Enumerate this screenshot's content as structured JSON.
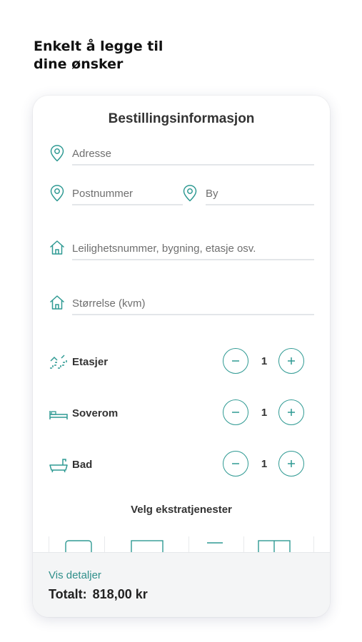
{
  "headline": {
    "line1": "Enkelt å legge til",
    "line2": "dine ønsker"
  },
  "form": {
    "title": "Bestillingsinformasjon",
    "address_placeholder": "Adresse",
    "postnummer_placeholder": "Postnummer",
    "by_placeholder": "By",
    "apartment_placeholder": "Leilighetsnummer, bygning, etasje osv.",
    "size_placeholder": "Størrelse (kvm)"
  },
  "counters": [
    {
      "label": "Etasjer",
      "value": "1",
      "icon": "stairs-icon"
    },
    {
      "label": "Soverom",
      "value": "1",
      "icon": "bed-icon"
    },
    {
      "label": "Bad",
      "value": "1",
      "icon": "bathtub-icon"
    }
  ],
  "extras": {
    "title": "Velg ekstratjenester"
  },
  "footer": {
    "details_link": "Vis detaljer",
    "total_label": "Totalt:",
    "total_value": "818,00 kr"
  },
  "colors": {
    "accent": "#2f9a93",
    "footer_bg": "#f4f5f6",
    "divider": "#e3e6e9"
  }
}
